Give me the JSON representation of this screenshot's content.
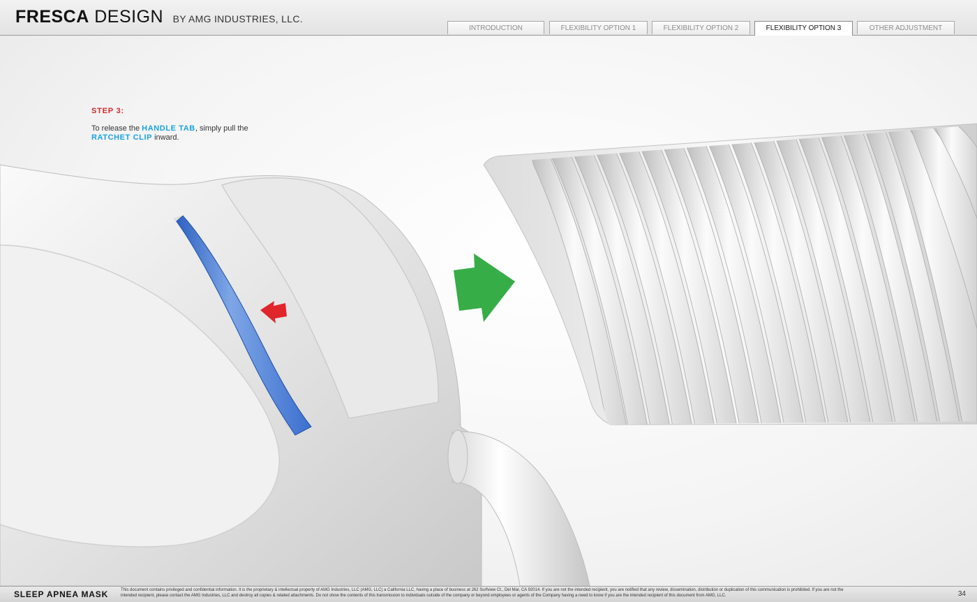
{
  "header": {
    "brand_bold": "FRESCA",
    "brand_light": "DESIGN",
    "brand_by": "BY AMG INDUSTRIES, LLC."
  },
  "tabs": [
    {
      "label": "INTRODUCTION",
      "active": false
    },
    {
      "label": "FLEXIBILITY OPTION 1",
      "active": false
    },
    {
      "label": "FLEXIBILITY OPTION 2",
      "active": false
    },
    {
      "label": "FLEXIBILITY OPTION 3",
      "active": true
    },
    {
      "label": "OTHER ADJUSTMENT",
      "active": false
    }
  ],
  "content": {
    "step_label": "STEP 3:",
    "instr_part1": "To release the ",
    "instr_highlight1": "HANDLE TAB",
    "instr_part2": ", simply pull the ",
    "instr_highlight2": "RATCHET CLIP",
    "instr_part3": " inward."
  },
  "footer": {
    "product_name": "SLEEP APNEA MASK",
    "legal_text": "This document contains privileged and confidential information. It is the proprietary & intellectual property of AMG Industries, LLC (AMG, LLC) a California LLC, having a place of business at 262 Surfview Ct., Del Mar, CA 92014. If you are not the intended recipient, you are notified that any review, dissemination, distribution or duplication of this communication is prohibited. If you are not the intended recipient, please contact the AMG Industries, LLC and destroy all copies & related attachments. Do not show the contents of this transmission to individuals outside of the company or beyond employees or agents of the Company having a need to know if you are the intended recipient of this document from AMG, LLC.",
    "page_number": "34"
  },
  "colors": {
    "step_red": "#d6262b",
    "highlight_blue": "#1aa3e0",
    "arrow_green": "#36ad47",
    "arrow_red": "#e0252b",
    "clip_blue": "#5b8ad6"
  },
  "icons": {
    "green_arrow": "arrow-right-icon",
    "red_arrow": "arrow-left-icon"
  }
}
